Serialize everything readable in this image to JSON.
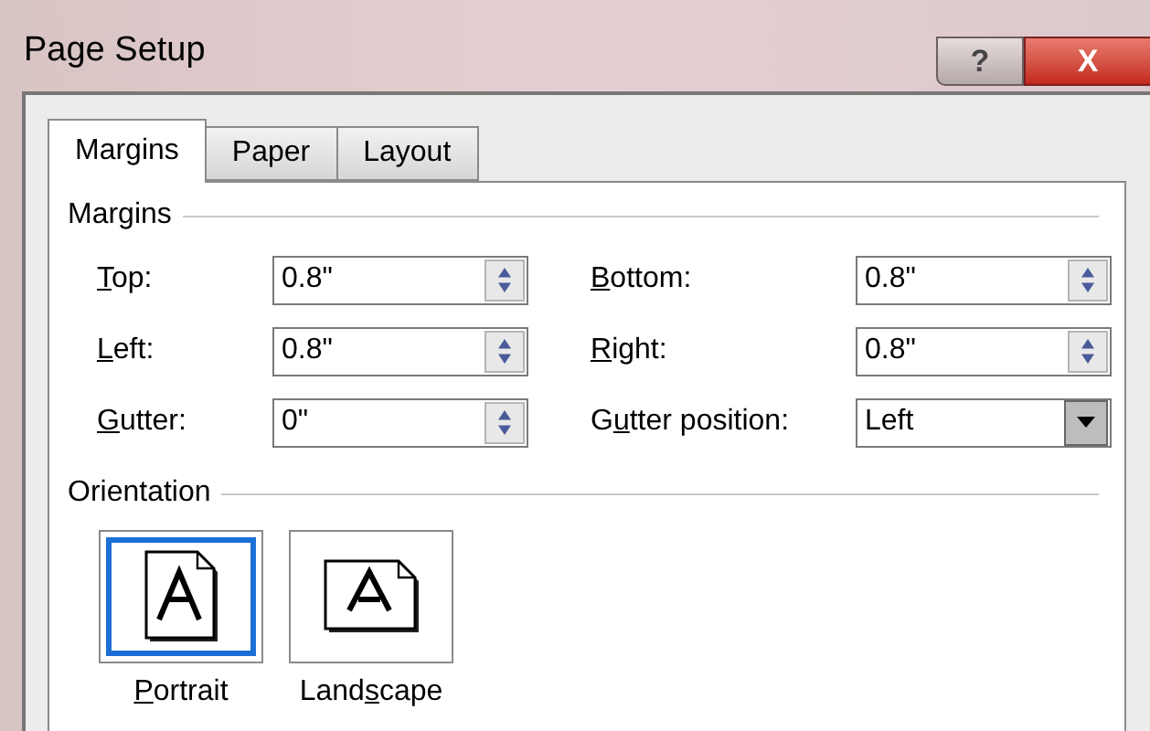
{
  "window": {
    "title": "Page Setup",
    "help": "?",
    "close": "X"
  },
  "tabs": [
    {
      "label": "Margins",
      "selected": true
    },
    {
      "label": "Paper",
      "selected": false
    },
    {
      "label": "Layout",
      "selected": false
    }
  ],
  "margins_group": {
    "title": "Margins",
    "fields": [
      {
        "kind": "spin",
        "label": {
          "key": "T",
          "after": "op:"
        },
        "value": "0.8\""
      },
      {
        "kind": "spin",
        "label": {
          "key": "B",
          "after": "ottom:"
        },
        "value": "0.8\""
      },
      {
        "kind": "spin",
        "label": {
          "key": "L",
          "after": "eft:"
        },
        "value": "0.8\""
      },
      {
        "kind": "spin",
        "label": {
          "key": "R",
          "after": "ight:"
        },
        "value": "0.8\""
      },
      {
        "kind": "spin",
        "label": {
          "key": "G",
          "after": "utter:"
        },
        "value": "0\""
      },
      {
        "kind": "dropdown",
        "label": {
          "before": "G",
          "key": "u",
          "after": "tter position:"
        },
        "value": "Left"
      }
    ]
  },
  "orientation_group": {
    "title": "Orientation",
    "options": [
      {
        "kind": "portrait",
        "label": {
          "key": "P",
          "after": "ortrait"
        },
        "selected": true
      },
      {
        "kind": "landscape",
        "label": {
          "before": "Land",
          "key": "s",
          "after": "cape"
        },
        "selected": false
      }
    ]
  }
}
